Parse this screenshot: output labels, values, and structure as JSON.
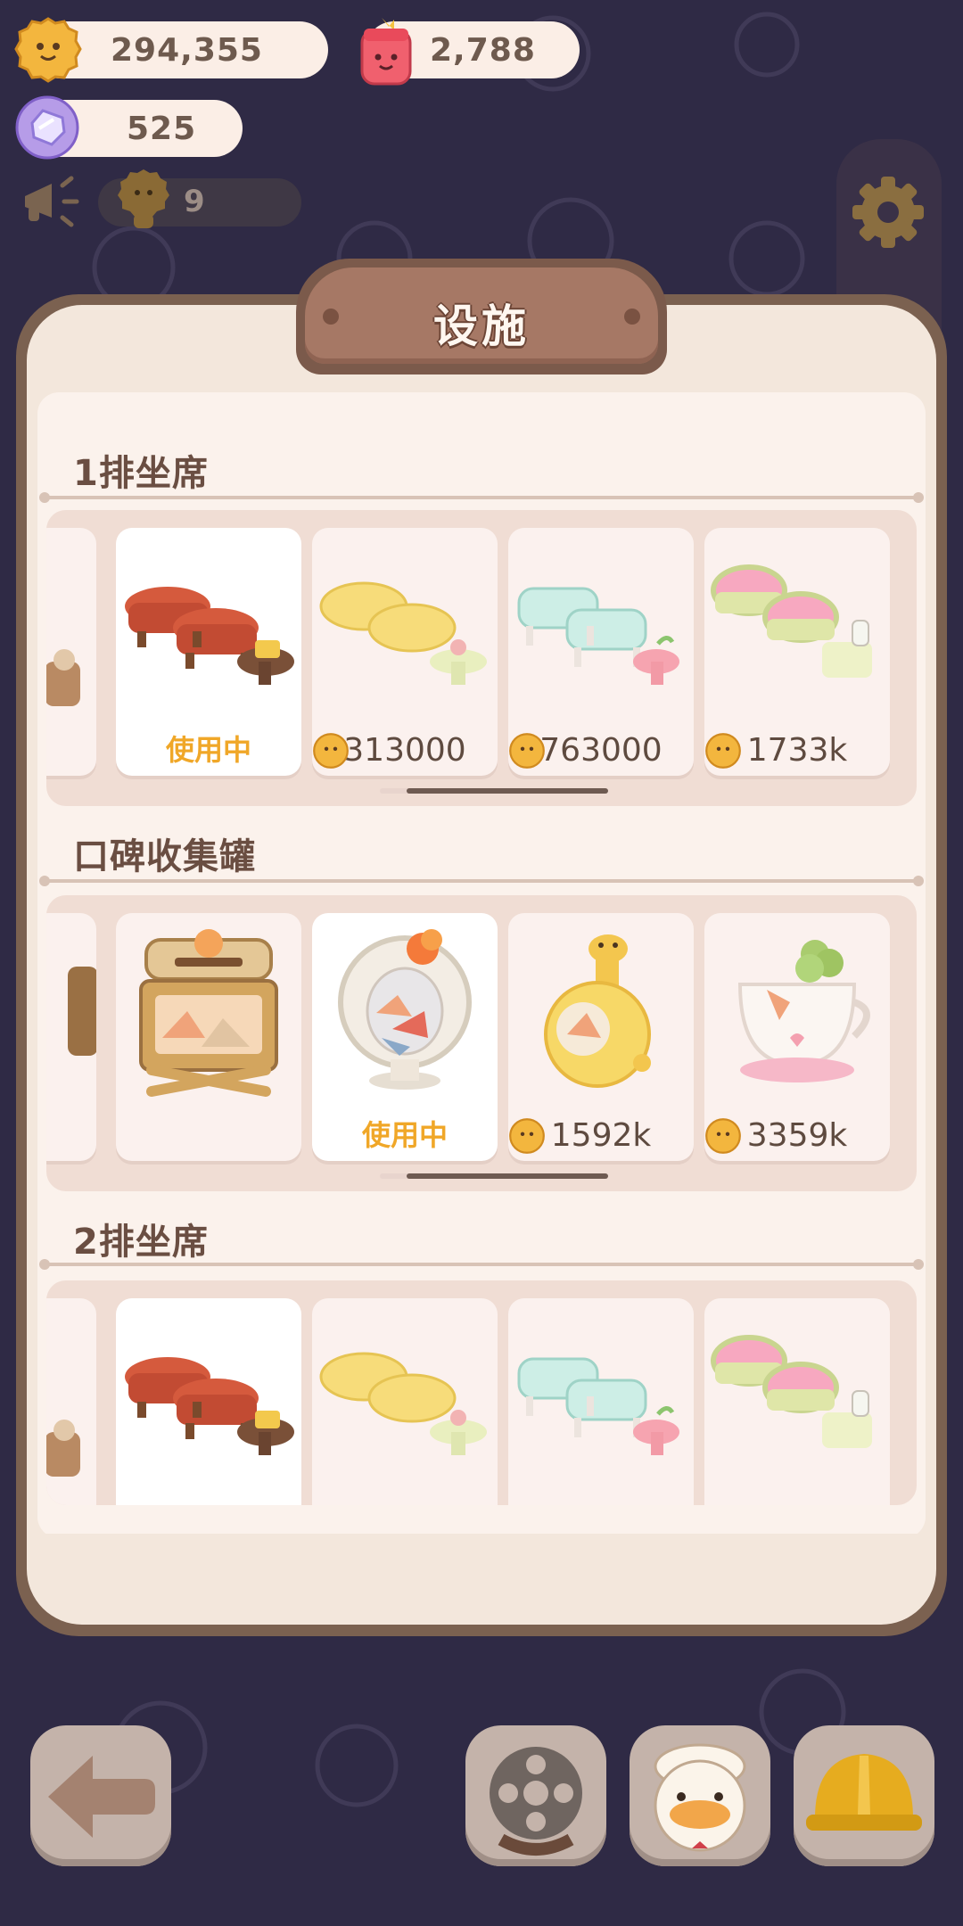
{
  "hud": {
    "coins": "294,355",
    "jam": "2,788",
    "gems": "525",
    "helpers": "9"
  },
  "panel": {
    "title": "设施"
  },
  "sections": [
    {
      "title": "1排坐席",
      "cards": [
        {
          "name": "red-sofa",
          "status": "使用中"
        },
        {
          "name": "yellow-sofa",
          "price": "313000"
        },
        {
          "name": "mint-sofa",
          "price": "763000"
        },
        {
          "name": "pink-sofa",
          "price": "1733k"
        }
      ]
    },
    {
      "title": "口碑收集罐",
      "cards": [
        {
          "name": "wooden-box"
        },
        {
          "name": "glass-jar",
          "status": "使用中"
        },
        {
          "name": "giraffe-jar",
          "price": "1592k"
        },
        {
          "name": "teacup-jar",
          "price": "3359k"
        }
      ]
    },
    {
      "title": "2排坐席",
      "cards": [
        {
          "name": "red-sofa"
        },
        {
          "name": "yellow-sofa"
        },
        {
          "name": "mint-sofa"
        },
        {
          "name": "pink-sofa"
        }
      ]
    }
  ],
  "icons": {
    "coin": "cookie-coin-icon",
    "jam": "jam-jar-icon",
    "gem": "gem-icon",
    "settings": "gear-icon",
    "back": "back-arrow-icon",
    "film": "film-reel-icon",
    "duck": "duck-chef-icon",
    "helmet": "hard-hat-icon"
  },
  "colors": {
    "background": "#2f2a45",
    "panel_border": "#7b6150",
    "panel_fill": "#fbf2ec",
    "status_text": "#f0a728",
    "price_text": "#5e4a3f"
  }
}
